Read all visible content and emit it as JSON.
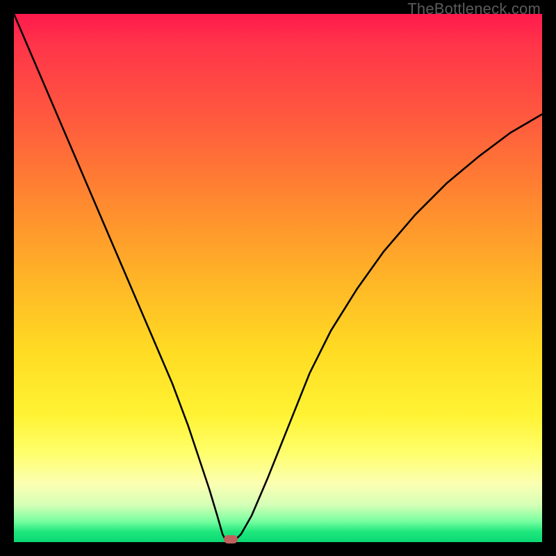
{
  "watermark": "TheBottleneck.com",
  "chart_data": {
    "type": "line",
    "title": "",
    "xlabel": "",
    "ylabel": "",
    "xlim": [
      0,
      100
    ],
    "ylim": [
      0,
      100
    ],
    "grid": false,
    "series": [
      {
        "name": "curve",
        "x": [
          0,
          3,
          6,
          9,
          12,
          15,
          18,
          21,
          24,
          27,
          30,
          33,
          35,
          37,
          38.5,
          39.5,
          40,
          41,
          42,
          43,
          45,
          48,
          52,
          56,
          60,
          65,
          70,
          76,
          82,
          88,
          94,
          100
        ],
        "values": [
          100,
          93,
          86,
          79,
          72,
          65,
          58,
          51,
          44,
          37,
          30,
          22,
          16,
          10,
          5,
          1.5,
          0.5,
          0.5,
          0.5,
          1.5,
          5,
          12,
          22,
          32,
          40,
          48,
          55,
          62,
          68,
          73,
          77.5,
          81
        ]
      }
    ],
    "marker": {
      "x": 41,
      "y": 0.5
    },
    "background_gradient": {
      "top": "#ff1a4d",
      "mid": "#ffdc23",
      "bottom": "#0bd873"
    }
  }
}
